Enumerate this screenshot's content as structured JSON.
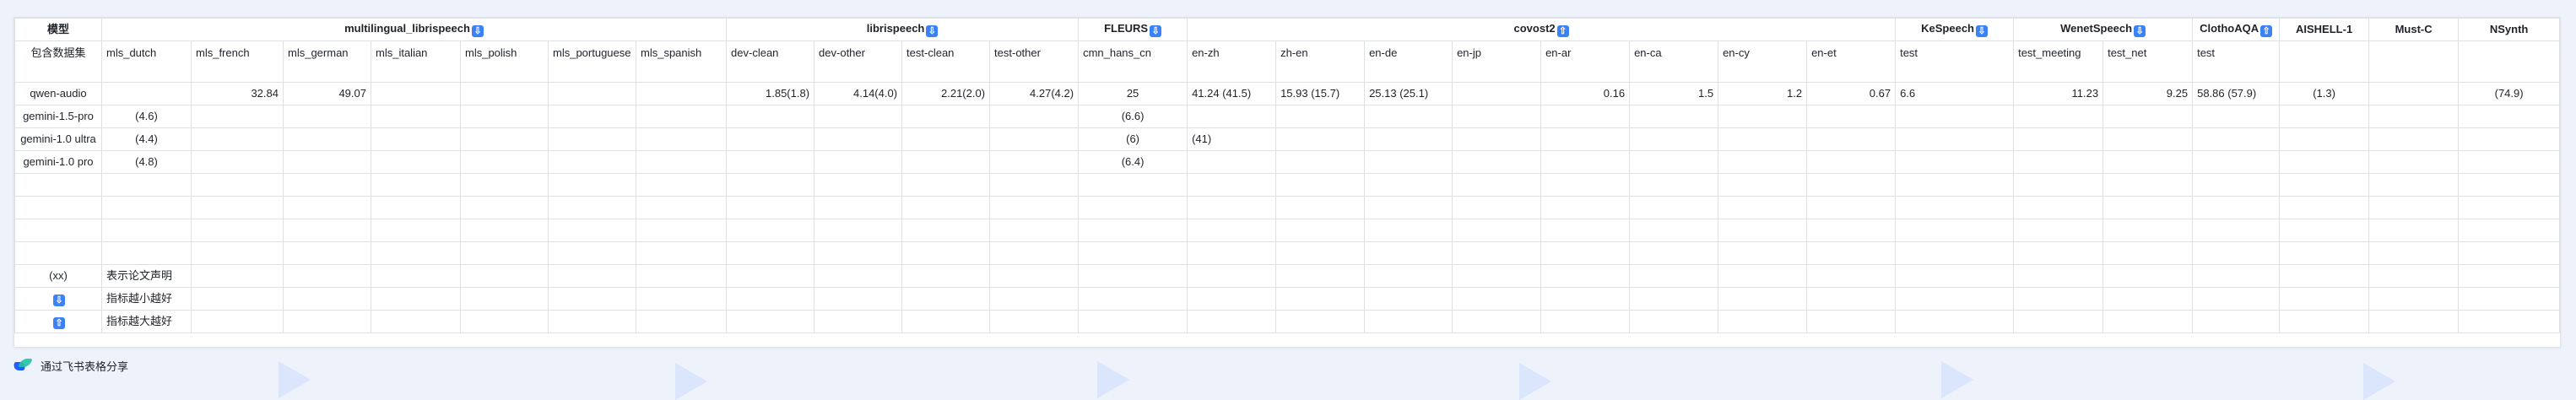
{
  "header": {
    "model_label": "模型",
    "groups": [
      {
        "label": "multilingual_librispeech",
        "icon": "down-arrow-icon"
      },
      {
        "label": "librispeech",
        "icon": "down-arrow-icon"
      },
      {
        "label": "FLEURS",
        "icon": "down-arrow-icon"
      },
      {
        "label": "covost2",
        "icon": "up-arrow-icon"
      },
      {
        "label": "KeSpeech",
        "icon": "down-arrow-icon"
      },
      {
        "label": "WenetSpeech",
        "icon": "down-arrow-icon"
      },
      {
        "label": "ClothoAQA",
        "icon": "up-arrow-icon"
      },
      {
        "label": "AISHELL-1",
        "icon": ""
      },
      {
        "label": "Must-C",
        "icon": ""
      },
      {
        "label": "NSynth",
        "icon": ""
      }
    ],
    "subset_label": "包含数据集",
    "subsets": [
      "mls_dutch",
      "mls_french",
      "mls_german",
      "mls_italian",
      "mls_polish",
      "mls_portuguese",
      "mls_spanish",
      "dev-clean",
      "dev-other",
      "test-clean",
      "test-other",
      "cmn_hans_cn",
      "en-zh",
      "zh-en",
      "en-de",
      "en-jp",
      "en-ar",
      "en-ca",
      "en-cy",
      "en-et",
      "test",
      "test_meeting",
      "test_net",
      "test",
      "",
      "",
      ""
    ]
  },
  "rows": [
    {
      "model": "qwen-audio",
      "cells": [
        "",
        "32.84",
        "49.07",
        "",
        "",
        "",
        "",
        "1.85(1.8)",
        "4.14(4.0)",
        "2.21(2.0)",
        "4.27(4.2)",
        "25",
        "41.24 (41.5)",
        "15.93 (15.7)",
        "25.13 (25.1)",
        "",
        "0.16",
        "1.5",
        "1.2",
        "0.67",
        "6.6",
        "11.23",
        "9.25",
        "58.86 (57.9)",
        "(1.3)",
        "",
        "(74.9)"
      ]
    },
    {
      "model": "gemini-1.5-pro",
      "cells": [
        "(4.6)",
        "",
        "",
        "",
        "",
        "",
        "",
        "",
        "",
        "",
        "",
        "(6.6)",
        "",
        "",
        "",
        "",
        "",
        "",
        "",
        "",
        "",
        "",
        "",
        "",
        "",
        "",
        ""
      ]
    },
    {
      "model": "gemini-1.0 ultra",
      "cells": [
        "(4.4)",
        "",
        "",
        "",
        "",
        "",
        "",
        "",
        "",
        "",
        "",
        "(6)",
        "(41)",
        "",
        "",
        "",
        "",
        "",
        "",
        "",
        "",
        "",
        "",
        "",
        "",
        "",
        ""
      ]
    },
    {
      "model": "gemini-1.0 pro",
      "cells": [
        "(4.8)",
        "",
        "",
        "",
        "",
        "",
        "",
        "",
        "",
        "",
        "",
        "(6.4)",
        "",
        "",
        "",
        "",
        "",
        "",
        "",
        "",
        "",
        "",
        "",
        "",
        "",
        "",
        ""
      ]
    }
  ],
  "legend": [
    {
      "key": "(xx)",
      "text": "表示论文声明",
      "icon": ""
    },
    {
      "key": "",
      "text": "指标越小越好",
      "icon": "down-arrow-icon"
    },
    {
      "key": "",
      "text": "指标越大越好",
      "icon": "up-arrow-icon"
    }
  ],
  "footer": {
    "text": "通过飞书表格分享",
    "logo": "feishu-logo-icon"
  },
  "colors": {
    "accent": "#3b82f6",
    "border": "#dee0e3",
    "background": "#eef2fb"
  }
}
